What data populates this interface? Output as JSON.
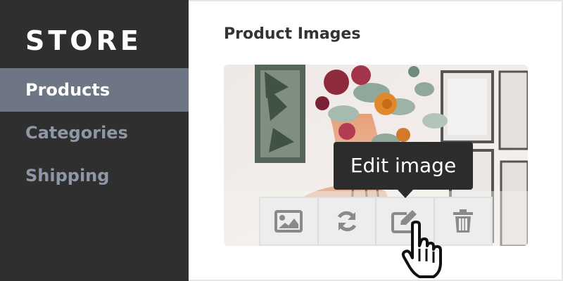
{
  "sidebar": {
    "logo": "STORE",
    "items": [
      {
        "label": "Products",
        "active": true
      },
      {
        "label": "Categories",
        "active": false
      },
      {
        "label": "Shipping",
        "active": false
      }
    ]
  },
  "main": {
    "title": "Product Images",
    "image": {
      "toolbar": {
        "buttons": [
          {
            "icon": "image-icon"
          },
          {
            "icon": "refresh-icon"
          },
          {
            "icon": "edit-icon"
          },
          {
            "icon": "trash-icon"
          }
        ]
      },
      "tooltip": "Edit image"
    }
  },
  "colors": {
    "sidebar_bg": "#2f2f2f",
    "active_bg": "#6e7585",
    "nav_inactive": "#8f97a7",
    "icon": "#8a8a8a",
    "tooltip_bg": "#2c2c2c"
  }
}
